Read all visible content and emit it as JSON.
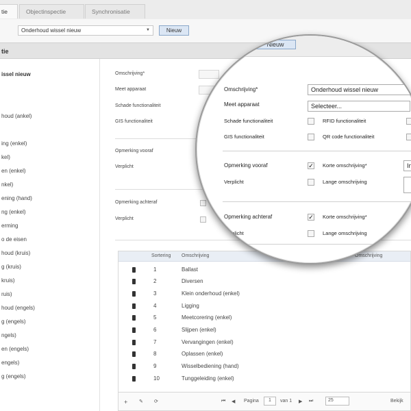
{
  "tabs": [
    "tie",
    "Objectinspectie",
    "Synchronisatie"
  ],
  "toolbar": {
    "select_value": "Onderhoud wissel nieuw",
    "new_button": "Nieuw"
  },
  "section_title": "tie",
  "left_list": {
    "title": "issel nieuw",
    "items": [
      "houd (ankel)",
      "ing (enkel)",
      "kel)",
      "en (enkel)",
      "nkel)",
      "ening (hand)",
      "ng (enkel)",
      "erming",
      "o de eisen",
      "houd (kruis)",
      "g (kruis)",
      "kruis)",
      "ruis)",
      "houd (engels)",
      "g (engels)",
      "ngels)",
      "en (engels)",
      "engels)",
      "g (engels)"
    ]
  },
  "form": {
    "omschrijving": "Omschrijving*",
    "meet_apparaat": "Meet apparaat",
    "schade": "Schade functionaliteit",
    "gis": "GIS functionaliteit",
    "opmerking_vooraf": "Opmerking vooraf",
    "verplicht": "Verplicht",
    "opmerking_achteraf": "Opmerking achteraf",
    "verplicht2": "Verplicht"
  },
  "table": {
    "headers": [
      "Sortering",
      "Omschrijving",
      "Omschrijving"
    ],
    "rows": [
      {
        "num": "1",
        "desc": "Ballast"
      },
      {
        "num": "2",
        "desc": "Diversen"
      },
      {
        "num": "3",
        "desc": "Klein onderhoud (enkel)"
      },
      {
        "num": "4",
        "desc": "Ligging"
      },
      {
        "num": "5",
        "desc": "Meetcorering (enkel)"
      },
      {
        "num": "6",
        "desc": "Slijpen (enkel)"
      },
      {
        "num": "7",
        "desc": "Vervangingen (enkel)"
      },
      {
        "num": "8",
        "desc": "Oplassen (enkel)"
      },
      {
        "num": "9",
        "desc": "Wisselbediening (hand)"
      },
      {
        "num": "10",
        "desc": "Tunggeleiding (enkel)"
      }
    ],
    "footer": {
      "pagina": "Pagina",
      "page_value": "1",
      "van": "van 1",
      "per_page": "25",
      "bekijk": "Bekijk"
    }
  },
  "magnifier": {
    "tab_label": "Nieuw",
    "omschrijving_label": "Omschrijving*",
    "omschrijving_value": "Onderhoud wissel nieuw",
    "meet_apparaat_label": "Meet apparaat",
    "meet_apparaat_value": "Selecteer...",
    "schade_label": "Schade functionaliteit",
    "rfid_label": "RFID functionaliteit",
    "gis_label": "GIS functionaliteit",
    "qr_label": "QR code functionaliteit",
    "opm_vooraf_label": "Opmerking vooraf",
    "korte1_label": "Korte omschrijving*",
    "korte1_value": "In",
    "verplicht1_label": "Verplicht",
    "lange1_label": "Lange omschrijving",
    "opm_achteraf_label": "Opmerking achteraf",
    "korte2_label": "Korte omschrijving*",
    "verplicht2_label": "Verplicht",
    "lange2_label": "Lange omschrijving",
    "check_mark": "✓"
  }
}
